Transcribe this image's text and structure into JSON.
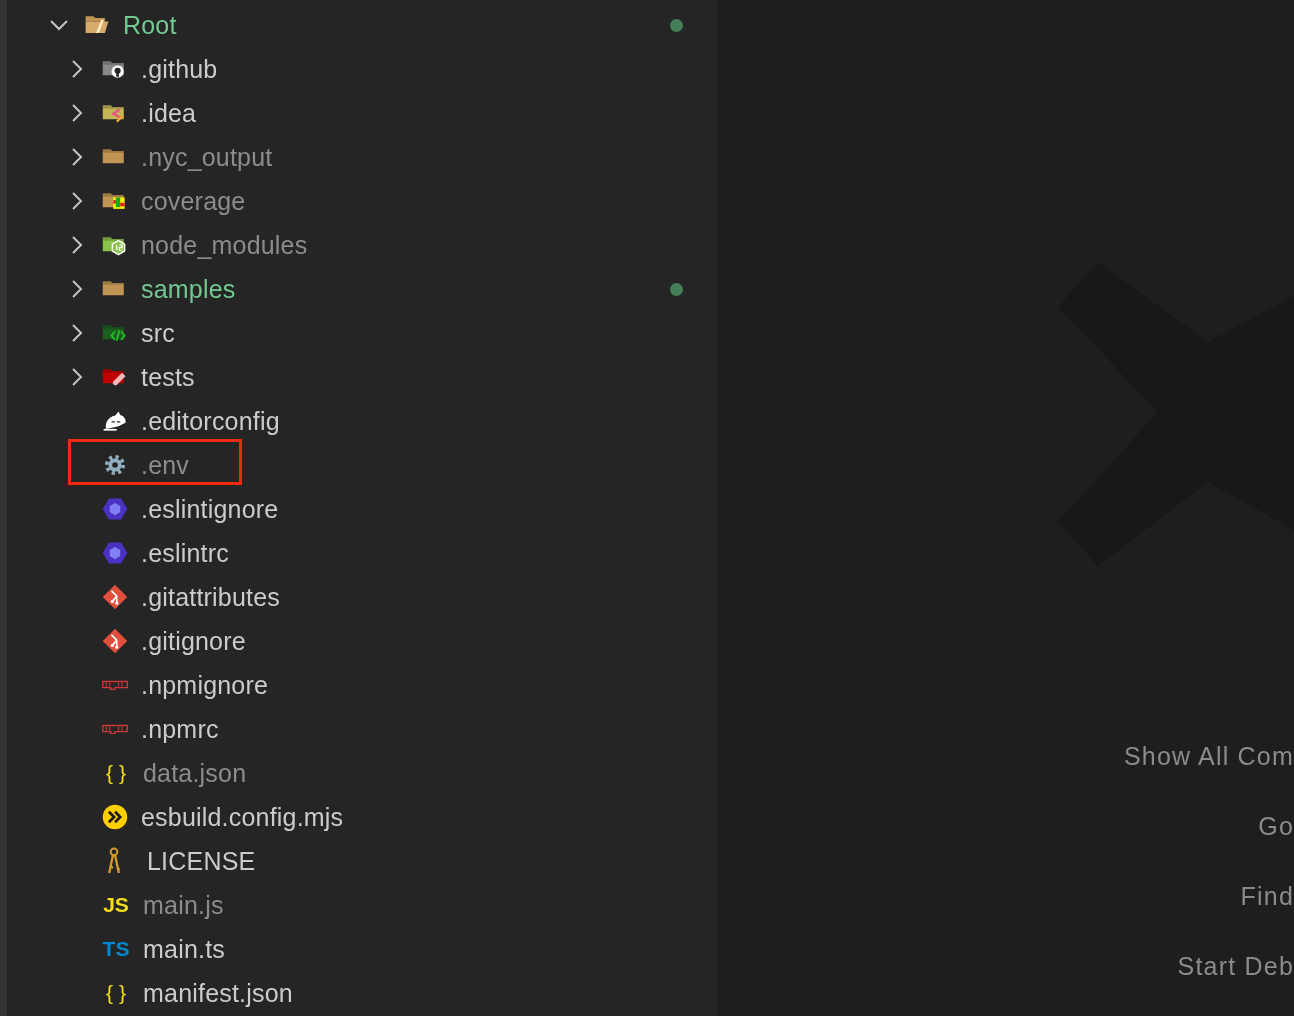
{
  "explorer": {
    "tree": [
      {
        "name": "Root",
        "kind": "root-folder",
        "expanded": true,
        "untracked": true,
        "ignored": false,
        "highlighted": false,
        "children": [
          {
            "name": ".github",
            "kind": "github-folder",
            "expanded": false,
            "untracked": false,
            "ignored": false,
            "highlighted": false
          },
          {
            "name": ".idea",
            "kind": "idea-folder",
            "expanded": false,
            "untracked": false,
            "ignored": false,
            "highlighted": false
          },
          {
            "name": ".nyc_output",
            "kind": "plain-folder",
            "expanded": false,
            "untracked": false,
            "ignored": true,
            "highlighted": false
          },
          {
            "name": "coverage",
            "kind": "coverage-folder",
            "expanded": false,
            "untracked": false,
            "ignored": true,
            "highlighted": false
          },
          {
            "name": "node_modules",
            "kind": "node-folder",
            "expanded": false,
            "untracked": false,
            "ignored": true,
            "highlighted": false
          },
          {
            "name": "samples",
            "kind": "plain-folder",
            "expanded": false,
            "untracked": true,
            "ignored": false,
            "highlighted": false
          },
          {
            "name": "src",
            "kind": "src-folder",
            "expanded": false,
            "untracked": false,
            "ignored": false,
            "highlighted": false
          },
          {
            "name": "tests",
            "kind": "tests-folder",
            "expanded": false,
            "untracked": false,
            "ignored": false,
            "highlighted": false
          },
          {
            "name": ".editorconfig",
            "kind": "editorconfig",
            "untracked": false,
            "ignored": false,
            "highlighted": false
          },
          {
            "name": ".env",
            "kind": "env",
            "untracked": false,
            "ignored": true,
            "highlighted": true
          },
          {
            "name": ".eslintignore",
            "kind": "eslint",
            "untracked": false,
            "ignored": false,
            "highlighted": false
          },
          {
            "name": ".eslintrc",
            "kind": "eslint",
            "untracked": false,
            "ignored": false,
            "highlighted": false
          },
          {
            "name": ".gitattributes",
            "kind": "git",
            "untracked": false,
            "ignored": false,
            "highlighted": false
          },
          {
            "name": ".gitignore",
            "kind": "git",
            "untracked": false,
            "ignored": false,
            "highlighted": false
          },
          {
            "name": ".npmignore",
            "kind": "npm",
            "untracked": false,
            "ignored": false,
            "highlighted": false
          },
          {
            "name": ".npmrc",
            "kind": "npm",
            "untracked": false,
            "ignored": false,
            "highlighted": false
          },
          {
            "name": "data.json",
            "kind": "json",
            "icon_text": "{ }",
            "untracked": false,
            "ignored": true,
            "highlighted": false
          },
          {
            "name": "esbuild.config.mjs",
            "kind": "esbuild",
            "untracked": false,
            "ignored": false,
            "highlighted": false
          },
          {
            "name": "LICENSE",
            "kind": "license",
            "untracked": false,
            "ignored": false,
            "highlighted": false
          },
          {
            "name": "main.js",
            "kind": "js",
            "icon_text": "JS",
            "untracked": false,
            "ignored": true,
            "highlighted": false
          },
          {
            "name": "main.ts",
            "kind": "ts",
            "icon_text": "TS",
            "untracked": false,
            "ignored": false,
            "highlighted": false
          },
          {
            "name": "manifest.json",
            "kind": "json",
            "icon_text": "{ }",
            "untracked": false,
            "ignored": false,
            "highlighted": false
          }
        ]
      }
    ]
  },
  "editor": {
    "commands": [
      "Show All Com",
      "Go",
      "Find",
      "Start Deb"
    ]
  }
}
